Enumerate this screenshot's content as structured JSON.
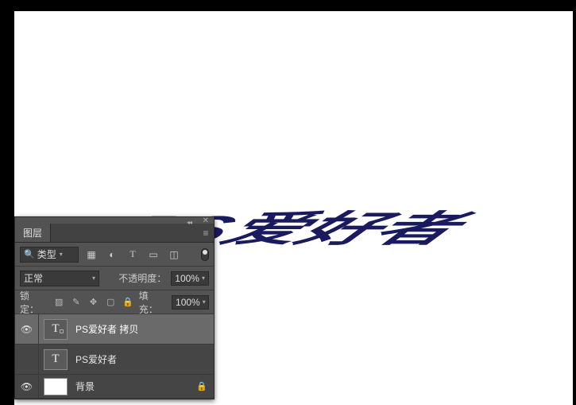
{
  "canvas": {
    "main_text": "PS爱好者",
    "text_color": "#1a1a5e"
  },
  "panel": {
    "tab_label": "图层",
    "filter": {
      "search_glyph": "🔍",
      "kind_label": "类型"
    },
    "blend": {
      "mode_label": "正常",
      "opacity_label": "不透明度：",
      "opacity_value": "100%"
    },
    "lock": {
      "label": "锁定：",
      "fill_label": "填充：",
      "fill_value": "100%"
    },
    "layers": [
      {
        "name": "PS爱好者 拷贝",
        "type": "T",
        "visible": true,
        "selected": true,
        "locked": false
      },
      {
        "name": "PS爱好者",
        "type": "T",
        "visible": false,
        "selected": false,
        "locked": false
      },
      {
        "name": "背景",
        "type": "bg",
        "visible": true,
        "selected": false,
        "locked": true
      }
    ]
  }
}
